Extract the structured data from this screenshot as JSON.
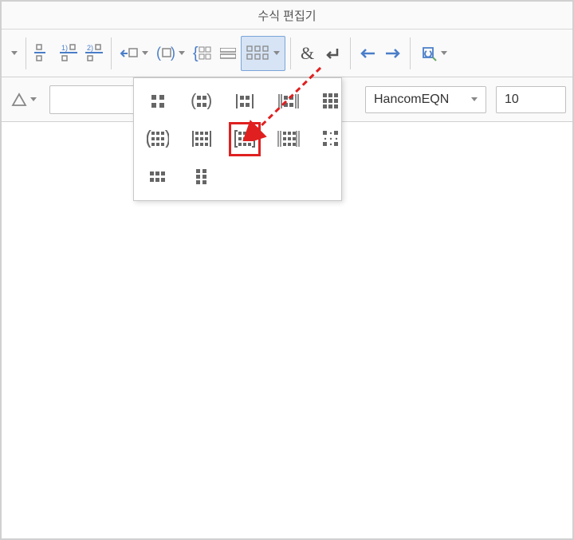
{
  "title": "수식 편집기",
  "toolbar": {
    "matrix_dropdown": {
      "highlighted": true
    }
  },
  "subbar": {
    "font_name": "HancomEQN",
    "font_size": "10"
  },
  "dropdown": {
    "items": [
      "2x2 행렬",
      "괄호 2x2 행렬",
      "세로선 2x2 행렬",
      "이중선 2x2 행렬",
      "3x3 행렬",
      "괄호 3x3 행렬",
      "세로 3x3 행렬",
      "대괄호 3x3 행렬",
      "이중 3x3 행렬",
      "점 3x3 행렬",
      "2x3 행렬",
      "3x2 행렬"
    ]
  }
}
